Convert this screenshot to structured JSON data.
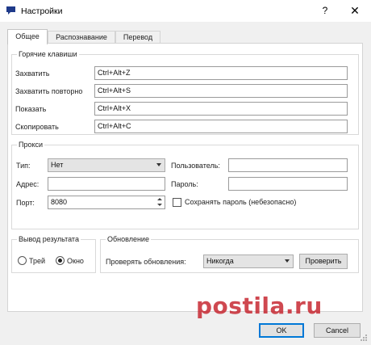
{
  "window": {
    "title": "Настройки",
    "help_glyph": "?",
    "close_glyph": "✕",
    "app_icon_color": "#1f3a8a"
  },
  "tabs": [
    {
      "label": "Общее",
      "active": true
    },
    {
      "label": "Распознавание",
      "active": false
    },
    {
      "label": "Перевод",
      "active": false
    }
  ],
  "hotkeys": {
    "title": "Горячие клавиши",
    "rows": [
      {
        "label": "Захватить",
        "value": "Ctrl+Alt+Z"
      },
      {
        "label": "Захватить повторно",
        "value": "Ctrl+Alt+S"
      },
      {
        "label": "Показать",
        "value": "Ctrl+Alt+X"
      },
      {
        "label": "Скопировать",
        "value": "Ctrl+Alt+C"
      }
    ]
  },
  "proxy": {
    "title": "Прокси",
    "type_label": "Тип:",
    "type_value": "Нет",
    "address_label": "Адрес:",
    "address_value": "",
    "port_label": "Порт:",
    "port_value": "8080",
    "user_label": "Пользователь:",
    "user_value": "",
    "password_label": "Пароль:",
    "password_value": "",
    "save_password_label": "Сохранять пароль (небезопасно)",
    "save_password_checked": false
  },
  "output": {
    "title": "Вывод результата",
    "options": [
      {
        "label": "Трей",
        "checked": false
      },
      {
        "label": "Окно",
        "checked": true
      }
    ]
  },
  "updates": {
    "title": "Обновление",
    "check_label": "Проверять обновления:",
    "frequency_value": "Никогда",
    "check_button": "Проверить"
  },
  "footer": {
    "ok_label": "OK",
    "cancel_label": "Cancel"
  },
  "watermark": {
    "text": "postila.ru",
    "color": "#c4202a"
  }
}
